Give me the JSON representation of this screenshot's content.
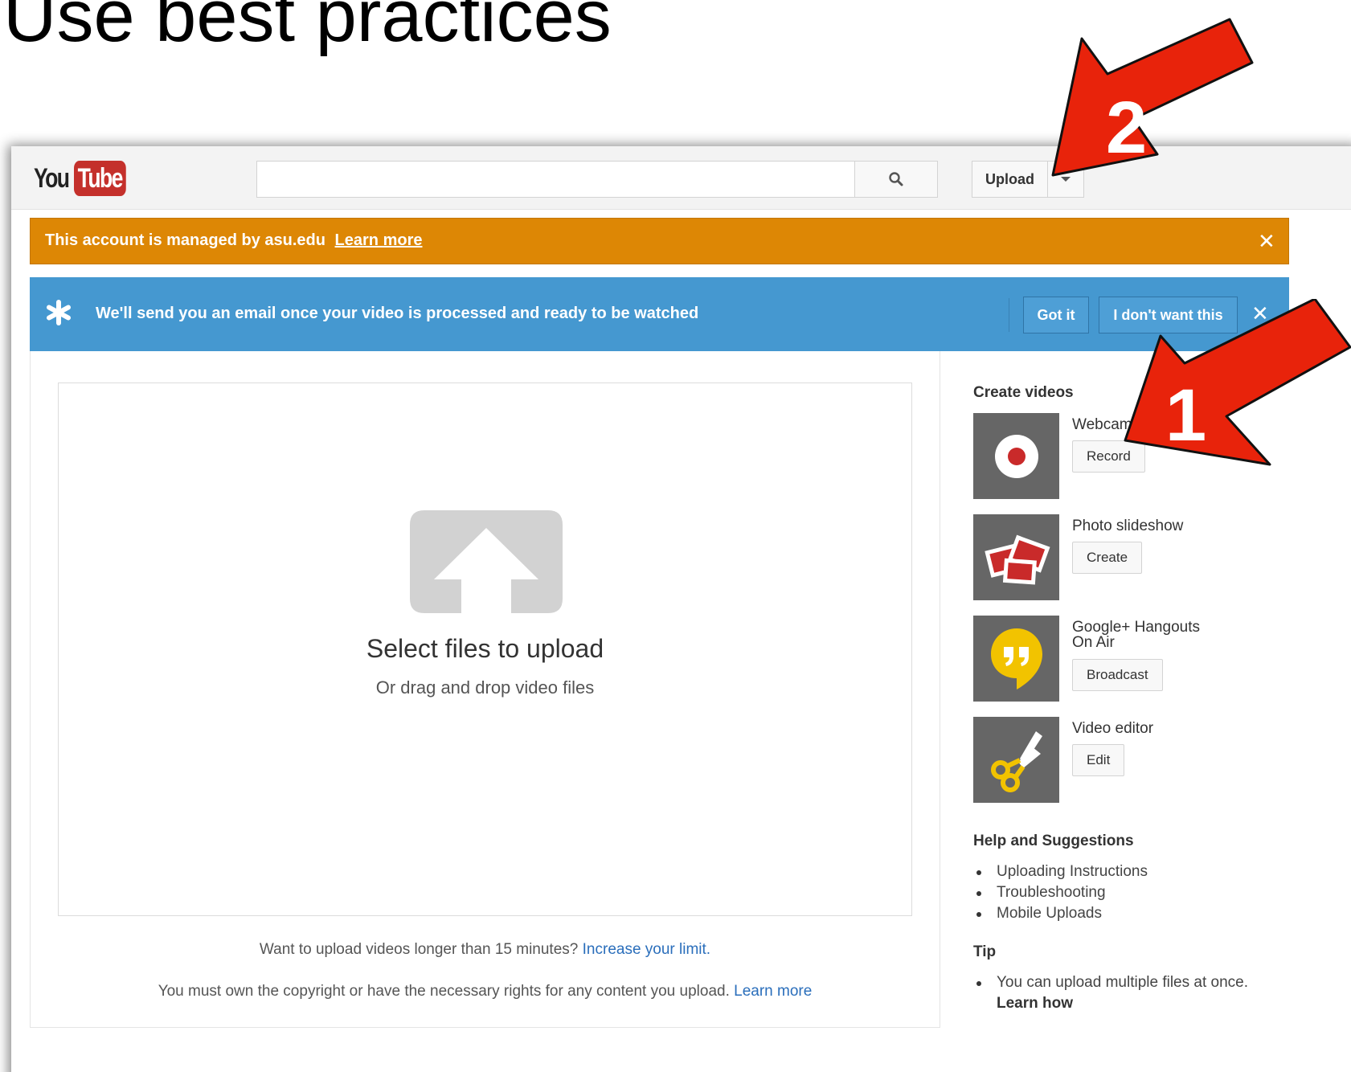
{
  "slide": {
    "title": "Use best practices"
  },
  "masthead": {
    "logo_you": "You",
    "logo_tube": "Tube",
    "search_placeholder": "",
    "upload_label": "Upload"
  },
  "managed_bar": {
    "text": "This account is managed by asu.edu",
    "link": "Learn more",
    "close": "✕"
  },
  "email_bar": {
    "text": "We'll send you an email once your video is processed and ready to be watched",
    "got_it": "Got it",
    "dont_want": "I don't want this",
    "close": "✕"
  },
  "upload_area": {
    "title": "Select files to upload",
    "subtitle": "Or drag and drop video files",
    "limit_text": "Want to upload videos longer than 15 minutes?",
    "limit_link": "Increase your limit.",
    "copyright_text": "You must own the copyright or have the necessary rights for any content you upload.",
    "copyright_link": "Learn more"
  },
  "sidebar": {
    "create_heading": "Create videos",
    "items": [
      {
        "title": "Webcam ca",
        "button": "Record",
        "icon": "record-icon"
      },
      {
        "title": "Photo slideshow",
        "button": "Create",
        "icon": "photos-icon"
      },
      {
        "title_line1": "Google+ Hangouts",
        "title_line2": "On Air",
        "button": "Broadcast",
        "icon": "hangouts-icon"
      },
      {
        "title": "Video editor",
        "button": "Edit",
        "icon": "scissors-icon"
      }
    ],
    "help_heading": "Help and Suggestions",
    "help_links": [
      "Uploading Instructions",
      "Troubleshooting",
      "Mobile Uploads"
    ],
    "tip_heading": "Tip",
    "tip_text": "You can upload multiple files at once.",
    "tip_link": "Learn how"
  },
  "annotations": {
    "arrow_1_label": "1",
    "arrow_2_label": "2",
    "arrow_color": "#e8230b"
  },
  "colors": {
    "managed_bar": "#dd8705",
    "email_bar": "#4598d0",
    "youtube_red": "#c4302b",
    "link_blue": "#2a6ebb"
  }
}
